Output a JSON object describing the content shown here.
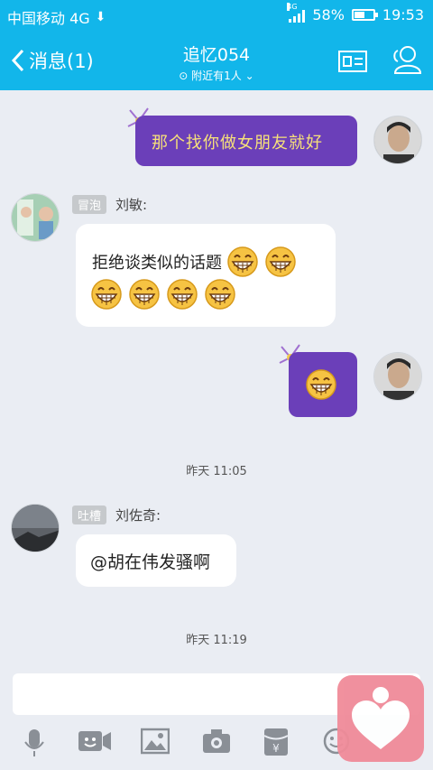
{
  "status": {
    "carrier": "中国移动 4G",
    "signal_label": "4G",
    "battery": "58%",
    "battery_level": 0.58,
    "time": "19:53"
  },
  "header": {
    "back_label": "消息(1)",
    "title": "追忆054",
    "subtitle": "附近有1人"
  },
  "messages": [
    {
      "side": "right",
      "style": "purple",
      "text": "那个找你做女朋友就好"
    },
    {
      "side": "left",
      "tag": "冒泡",
      "nick": "刘敏:",
      "text": "拒绝谈类似的话题",
      "emoji_count": 6
    },
    {
      "side": "right",
      "style": "purple",
      "emoji_count": 1
    },
    {
      "time": "昨天 11:05"
    },
    {
      "side": "left",
      "tag": "吐槽",
      "nick": "刘佐奇:",
      "text": "@胡在伟发骚啊"
    },
    {
      "time": "昨天 11:19"
    }
  ],
  "colors": {
    "accent": "#12b6ea",
    "bubble_purple": "#6b3fb9",
    "bubble_text": "#f6e07a",
    "float": "#f08b99"
  },
  "toolbar_icons": [
    "microphone-icon",
    "video-icon",
    "image-icon",
    "camera-icon",
    "red-packet-icon",
    "emoji-icon"
  ]
}
